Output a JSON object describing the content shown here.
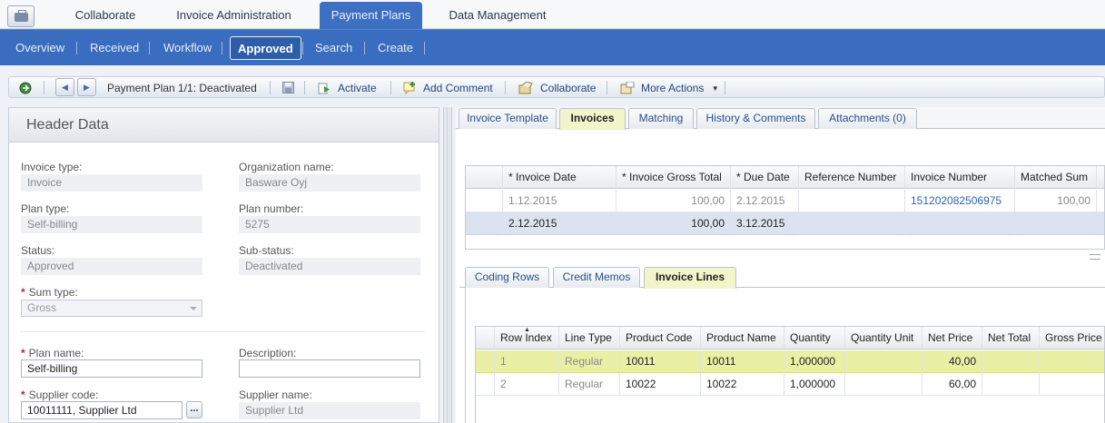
{
  "top_tabs": [
    {
      "label": "Collaborate",
      "active": false
    },
    {
      "label": "Invoice Administration",
      "active": false
    },
    {
      "label": "Payment Plans",
      "active": true
    },
    {
      "label": "Data Management",
      "active": false
    }
  ],
  "sub_nav": [
    {
      "label": "Overview"
    },
    {
      "label": "Received"
    },
    {
      "label": "Workflow"
    },
    {
      "label": "Approved",
      "active": true
    },
    {
      "label": "Search"
    },
    {
      "label": "Create"
    }
  ],
  "toolbar": {
    "record_label": "Payment Plan 1/1: Deactivated",
    "activate": "Activate",
    "add_comment": "Add Comment",
    "collaborate": "Collaborate",
    "more_actions": "More Actions"
  },
  "header_data": {
    "title": "Header Data",
    "invoice_type": {
      "label": "Invoice type:",
      "value": "Invoice"
    },
    "organization_name": {
      "label": "Organization name:",
      "value": "Basware Oyj"
    },
    "plan_type": {
      "label": "Plan type:",
      "value": "Self-billing"
    },
    "plan_number": {
      "label": "Plan number:",
      "value": "5275"
    },
    "status": {
      "label": "Status:",
      "value": "Approved"
    },
    "sub_status": {
      "label": "Sub-status:",
      "value": "Deactivated"
    },
    "sum_type": {
      "label": "Sum type:",
      "value": "Gross"
    },
    "plan_name": {
      "label": "Plan name:",
      "value": "Self-billing"
    },
    "description": {
      "label": "Description:",
      "value": ""
    },
    "supplier_code": {
      "label": "Supplier code:",
      "value": "10011111, Supplier Ltd",
      "lookup": "..."
    },
    "supplier_name": {
      "label": "Supplier name:",
      "value": "Supplier Ltd"
    }
  },
  "right_tabs": [
    {
      "label": "Invoice Template",
      "active": false
    },
    {
      "label": "Invoices",
      "active": true
    },
    {
      "label": "Matching",
      "active": false
    },
    {
      "label": "History & Comments",
      "active": false
    },
    {
      "label": "Attachments (0)",
      "active": false
    }
  ],
  "invoices_grid": {
    "columns": [
      "* Invoice Date",
      "* Invoice Gross Total",
      "* Due Date",
      "Reference Number",
      "Invoice Number",
      "Matched Sum"
    ],
    "rows": [
      {
        "invoice_date": "1.12.2015",
        "gross_total": "100,00",
        "due_date": "2.12.2015",
        "reference": "",
        "invoice_number": "151202082506975",
        "matched_sum": "100,00"
      },
      {
        "invoice_date": "2.12.2015",
        "gross_total": "100,00",
        "due_date": "3.12.2015",
        "reference": "",
        "invoice_number": "",
        "matched_sum": ""
      }
    ]
  },
  "lower_tabs": [
    {
      "label": "Coding Rows",
      "active": false
    },
    {
      "label": "Credit Memos",
      "active": false
    },
    {
      "label": "Invoice Lines",
      "active": true
    }
  ],
  "lines_grid": {
    "columns": [
      "Row Index",
      "Line Type",
      "Product Code",
      "Product Name",
      "Quantity",
      "Quantity Unit",
      "Net Price",
      "Net Total",
      "Gross Price"
    ],
    "rows": [
      {
        "row_index": "1",
        "line_type": "Regular",
        "product_code": "10011",
        "product_name": "10011",
        "quantity": "1,000000",
        "quantity_unit": "",
        "net_price": "40,00",
        "net_total": "",
        "gross_price": ""
      },
      {
        "row_index": "2",
        "line_type": "Regular",
        "product_code": "10022",
        "product_name": "10022",
        "quantity": "1,000000",
        "quantity_unit": "",
        "net_price": "60,00",
        "net_total": "",
        "gross_price": ""
      }
    ]
  },
  "colors": {
    "nav_blue": "#3a6cbf",
    "active_tab": "#f2f4c9",
    "selected_row": "#dbe3f1",
    "highlight_row": "#e9f0a6"
  }
}
